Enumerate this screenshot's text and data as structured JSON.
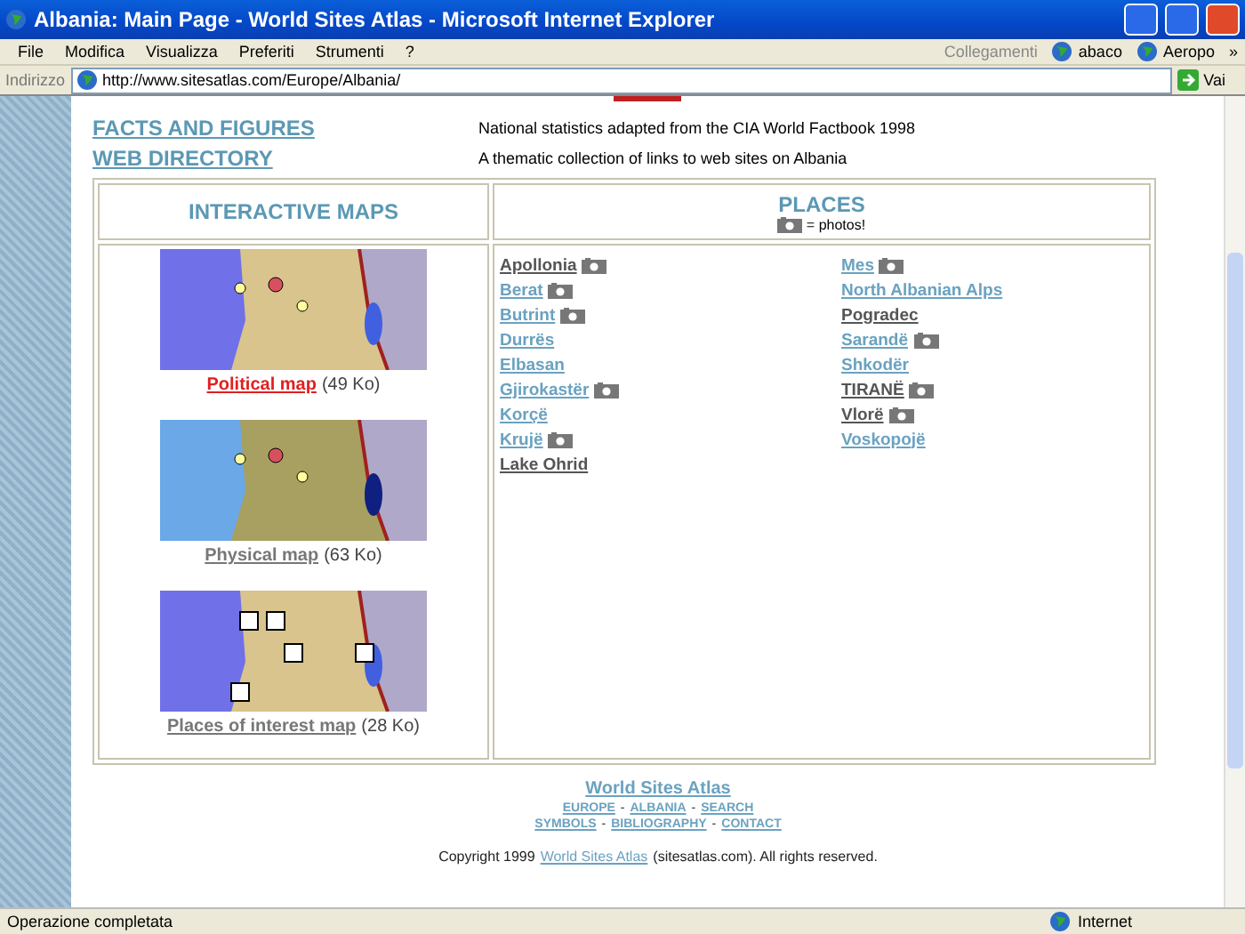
{
  "window": {
    "title": "Albania: Main Page - World Sites Atlas - Microsoft Internet Explorer"
  },
  "menu": [
    "File",
    "Modifica",
    "Visualizza",
    "Preferiti",
    "Strumenti",
    "?"
  ],
  "links_bar": {
    "label": "Collegamenti",
    "items": [
      "abaco",
      "Aeropo"
    ],
    "more": "»"
  },
  "address": {
    "label": "Indirizzo",
    "value": "http://www.sitesatlas.com/Europe/Albania/",
    "go": "Vai"
  },
  "sections": [
    {
      "title": "FACTS AND FIGURES",
      "description": "National statistics adapted from the CIA World Factbook 1998"
    },
    {
      "title": "WEB DIRECTORY",
      "description": "A thematic collection of links to web sites on Albania"
    }
  ],
  "maps": {
    "heading": "INTERACTIVE MAPS",
    "items": [
      {
        "kind": "political",
        "link": "Political map",
        "size": "(49 Ko)",
        "active": true
      },
      {
        "kind": "physical",
        "link": "Physical map",
        "size": "(63 Ko)",
        "active": false
      },
      {
        "kind": "interest",
        "link": "Places of interest map",
        "size": "(28 Ko)",
        "active": false
      }
    ]
  },
  "places": {
    "heading": "PLACES",
    "legend": "= photos!",
    "columns": [
      [
        {
          "name": "Apollonia",
          "visited": true,
          "photo": true
        },
        {
          "name": "Berat",
          "visited": false,
          "photo": true
        },
        {
          "name": "Butrint",
          "visited": false,
          "photo": true
        },
        {
          "name": "Durrës",
          "visited": false,
          "photo": false
        },
        {
          "name": "Elbasan",
          "visited": false,
          "photo": false
        },
        {
          "name": "Gjirokastër",
          "visited": false,
          "photo": true
        },
        {
          "name": "Korçë",
          "visited": false,
          "photo": false
        },
        {
          "name": "Krujë",
          "visited": false,
          "photo": true
        },
        {
          "name": "Lake Ohrid",
          "visited": true,
          "photo": false
        }
      ],
      [
        {
          "name": "Mes",
          "visited": false,
          "photo": true
        },
        {
          "name": "North Albanian Alps",
          "visited": false,
          "photo": false
        },
        {
          "name": "Pogradec",
          "visited": true,
          "photo": false
        },
        {
          "name": "Sarandë",
          "visited": false,
          "photo": true
        },
        {
          "name": "Shkodër",
          "visited": false,
          "photo": false
        },
        {
          "name": "TIRANË",
          "visited": true,
          "photo": true
        },
        {
          "name": "Vlorë",
          "visited": true,
          "photo": true
        },
        {
          "name": "Voskopojë",
          "visited": false,
          "photo": false
        }
      ]
    ]
  },
  "footer": {
    "title": "World Sites Atlas",
    "separator": "-",
    "nav": [
      [
        "EUROPE",
        "ALBANIA",
        "SEARCH"
      ],
      [
        "SYMBOLS",
        "BIBLIOGRAPHY",
        "CONTACT"
      ]
    ],
    "copyright": [
      "Copyright 1999",
      "World Sites Atlas",
      "(sitesatlas.com). All rights reserved."
    ]
  },
  "status_bar": {
    "text": "Operazione completata",
    "zone": "Internet"
  }
}
